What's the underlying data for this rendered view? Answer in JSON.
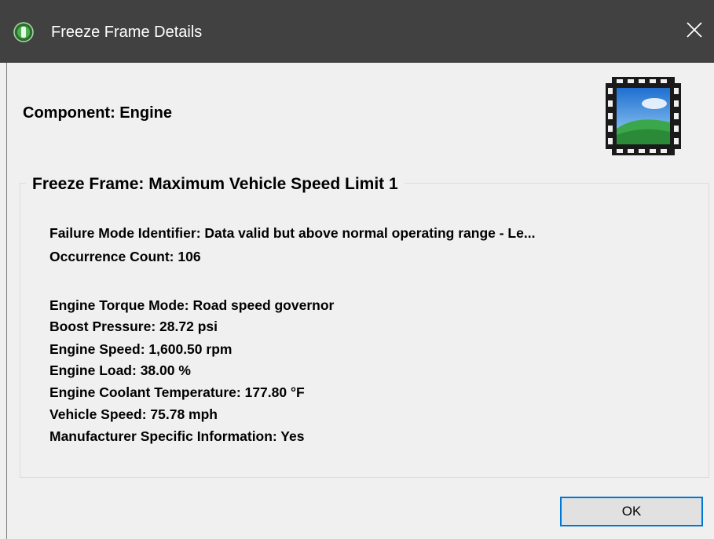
{
  "window": {
    "title": "Freeze Frame Details",
    "icon": "app-globe-icon",
    "close_icon": "close-icon"
  },
  "component": {
    "text": "Component:  Engine",
    "icon": "film-strip-icon"
  },
  "freeze_frame": {
    "title": "Freeze Frame:  Maximum Vehicle Speed Limit 1",
    "failure_mode": "Failure Mode Identifier: Data valid but above normal operating range - Le...",
    "occurrence_count": "Occurrence Count: 106",
    "parameters": [
      "Engine Torque Mode: Road speed governor",
      "Boost Pressure: 28.72 psi",
      "Engine Speed: 1,600.50 rpm",
      "Engine Load: 38.00 %",
      "Engine Coolant Temperature: 177.80 °F",
      "Vehicle Speed: 75.78 mph",
      "Manufacturer Specific Information: Yes"
    ]
  },
  "buttons": {
    "ok": "OK"
  },
  "colors": {
    "titlebar_bg": "#414141",
    "dialog_bg": "#f0f0f0",
    "button_focus_border": "#0078d7"
  }
}
